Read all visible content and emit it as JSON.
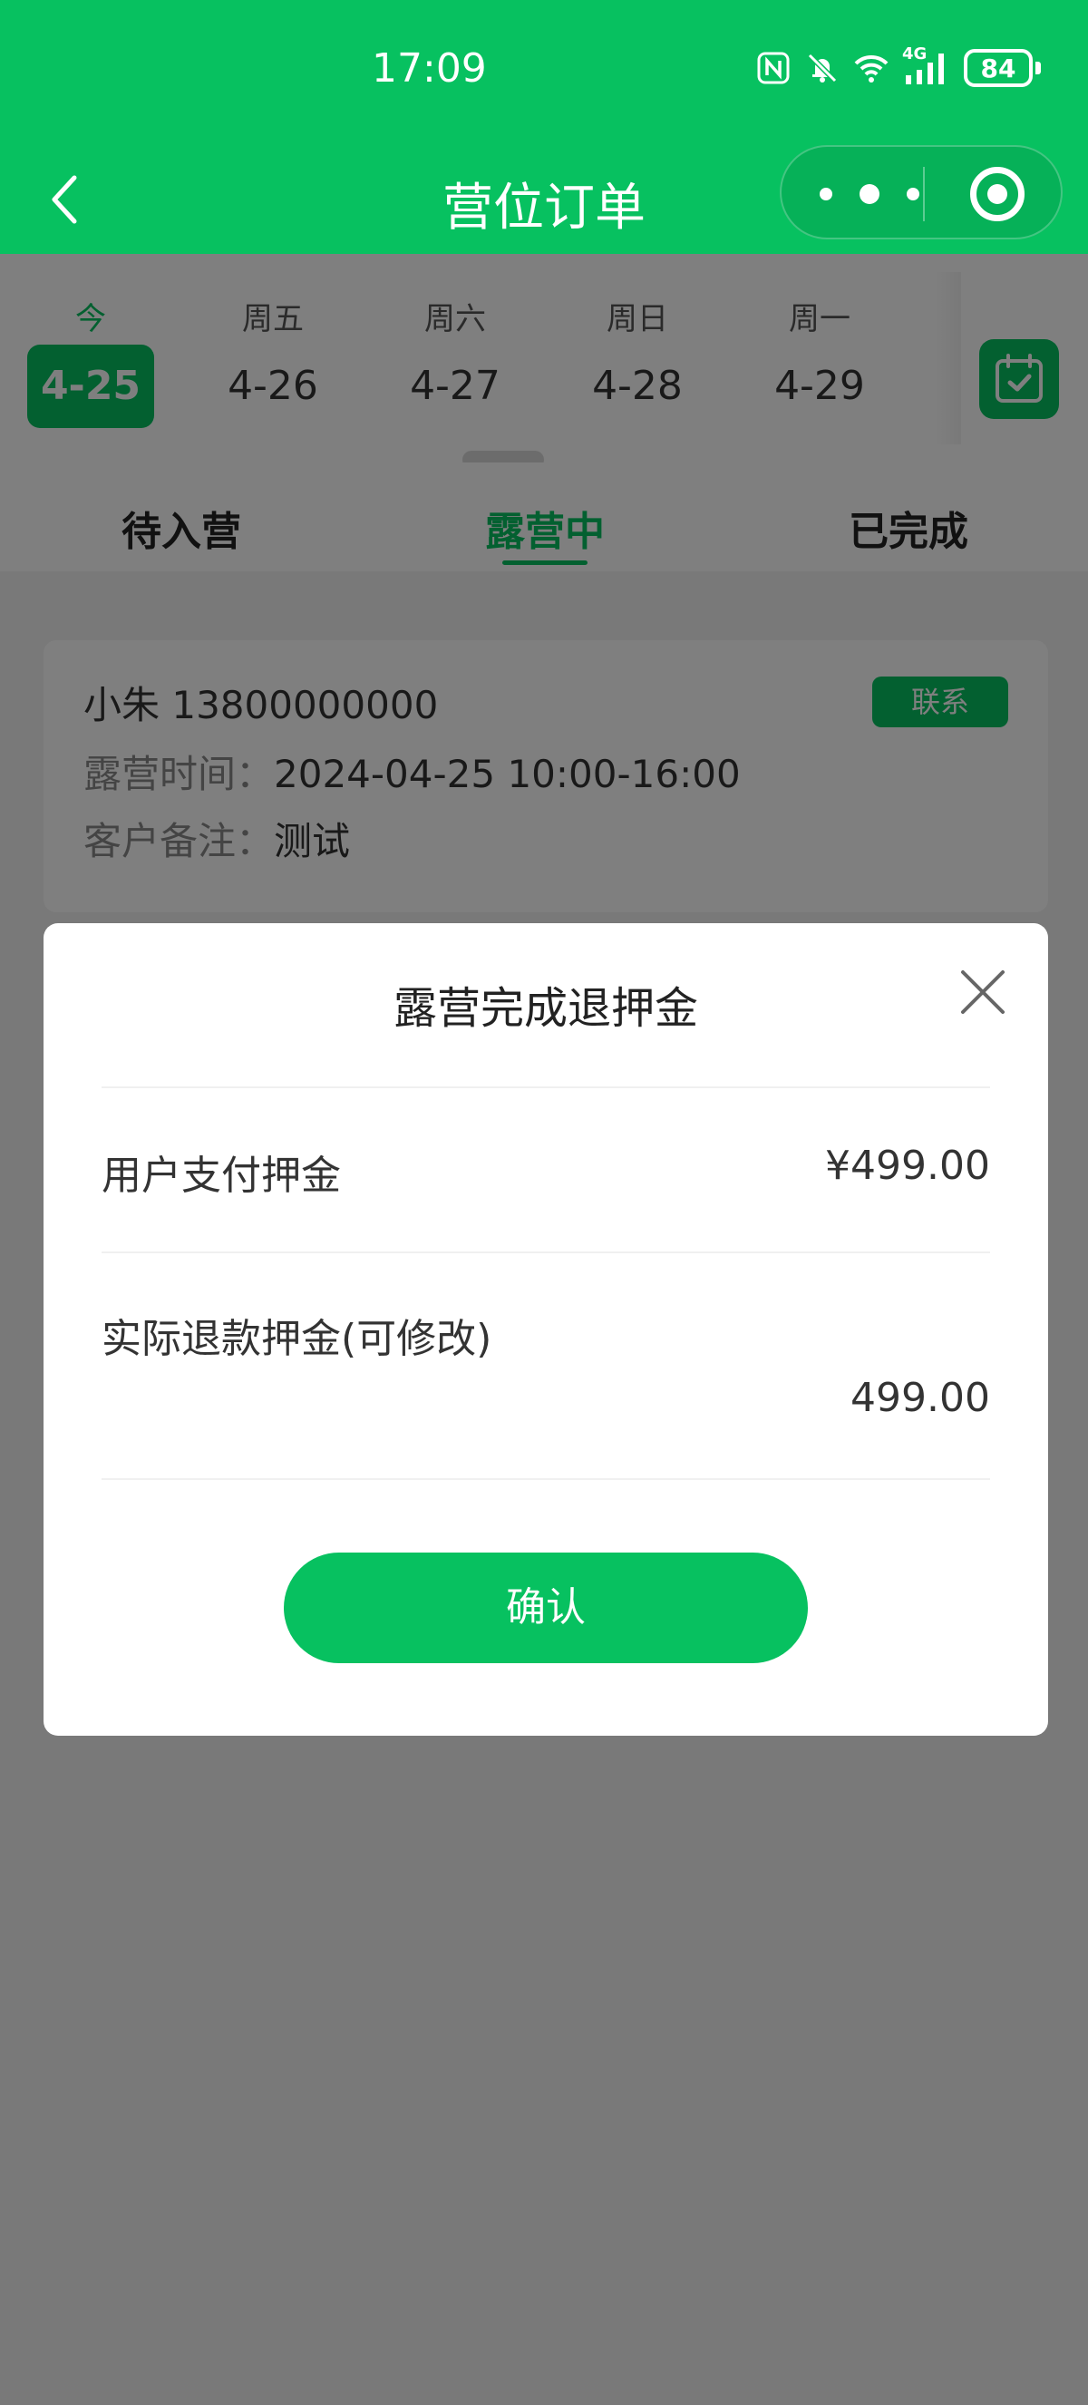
{
  "status_bar": {
    "time": "17:09",
    "icons": [
      "nfc-icon",
      "mute-bell-icon",
      "wifi-icon",
      "4g-signal-icon"
    ],
    "network_label": "4G",
    "battery_level": "84"
  },
  "nav": {
    "title": "营位订单",
    "back_icon": "chevron-left-icon",
    "more_icon": "more-dots-icon",
    "close_icon": "target-circle-icon"
  },
  "date_strip": {
    "dates": [
      {
        "weekday": "今",
        "date": "4-25",
        "selected": true
      },
      {
        "weekday": "周五",
        "date": "4-26",
        "selected": false
      },
      {
        "weekday": "周六",
        "date": "4-27",
        "selected": false
      },
      {
        "weekday": "周日",
        "date": "4-28",
        "selected": false
      },
      {
        "weekday": "周一",
        "date": "4-29",
        "selected": false
      }
    ],
    "calendar_icon": "calendar-check-icon"
  },
  "tabs": {
    "items": [
      {
        "label": "待入营",
        "active": false
      },
      {
        "label": "露营中",
        "active": true
      },
      {
        "label": "已完成",
        "active": false
      }
    ]
  },
  "order": {
    "customer": "小朱 13800000000",
    "contact_label": "联系",
    "time_label": "露营时间：",
    "time_value": "2024-04-25 10:00-16:00",
    "note_label": "客户备注：",
    "note_value": "测试"
  },
  "modal": {
    "title": "露营完成退押金",
    "close_icon": "close-x-icon",
    "deposit_label": "用户支付押金",
    "deposit_value": "¥499.00",
    "refund_label": "实际退款押金(可修改)",
    "refund_value": "499.00",
    "confirm_label": "确认"
  },
  "colors": {
    "brand": "#07c160",
    "overlay": "rgba(0,0,0,0.5)"
  }
}
